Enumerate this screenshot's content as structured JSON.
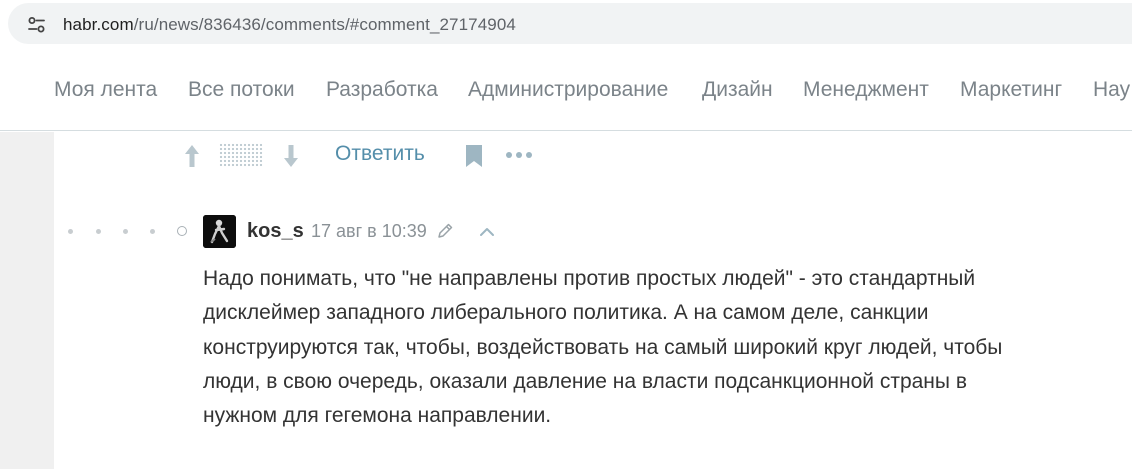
{
  "browser": {
    "url_host": "habr.com",
    "url_path": "/ru/news/836436/comments/#comment_27174904",
    "site_info_icon": "tune-icon"
  },
  "nav": {
    "items": [
      "Моя лента",
      "Все потоки",
      "Разработка",
      "Администрирование",
      "Дизайн",
      "Менеджмент",
      "Маркетинг",
      "Нау"
    ]
  },
  "actions": {
    "reply_label": "Ответить",
    "icons": [
      "arrow-up-icon",
      "arrow-down-icon",
      "bookmark-icon",
      "more-icon"
    ]
  },
  "comment": {
    "username": "kos_s",
    "timestamp": "17 авг в 10:39",
    "body_lines": [
      "Надо понимать, что \"не направлены против простых людей\" - это стандартный",
      "дисклеймер западного либерального политика. А на самом деле, санкции",
      "конструируются так, чтобы, воздействовать на самый широкий круг людей, чтобы",
      "люди, в свою очередь, оказали давление на власти подсанкционной страны в",
      "нужном для гегемона направлении."
    ]
  },
  "colors": {
    "nav_text": "#7b8389",
    "link_blue": "#548eaa",
    "body_text": "#333333",
    "page_bg": "#f0f0f0"
  }
}
